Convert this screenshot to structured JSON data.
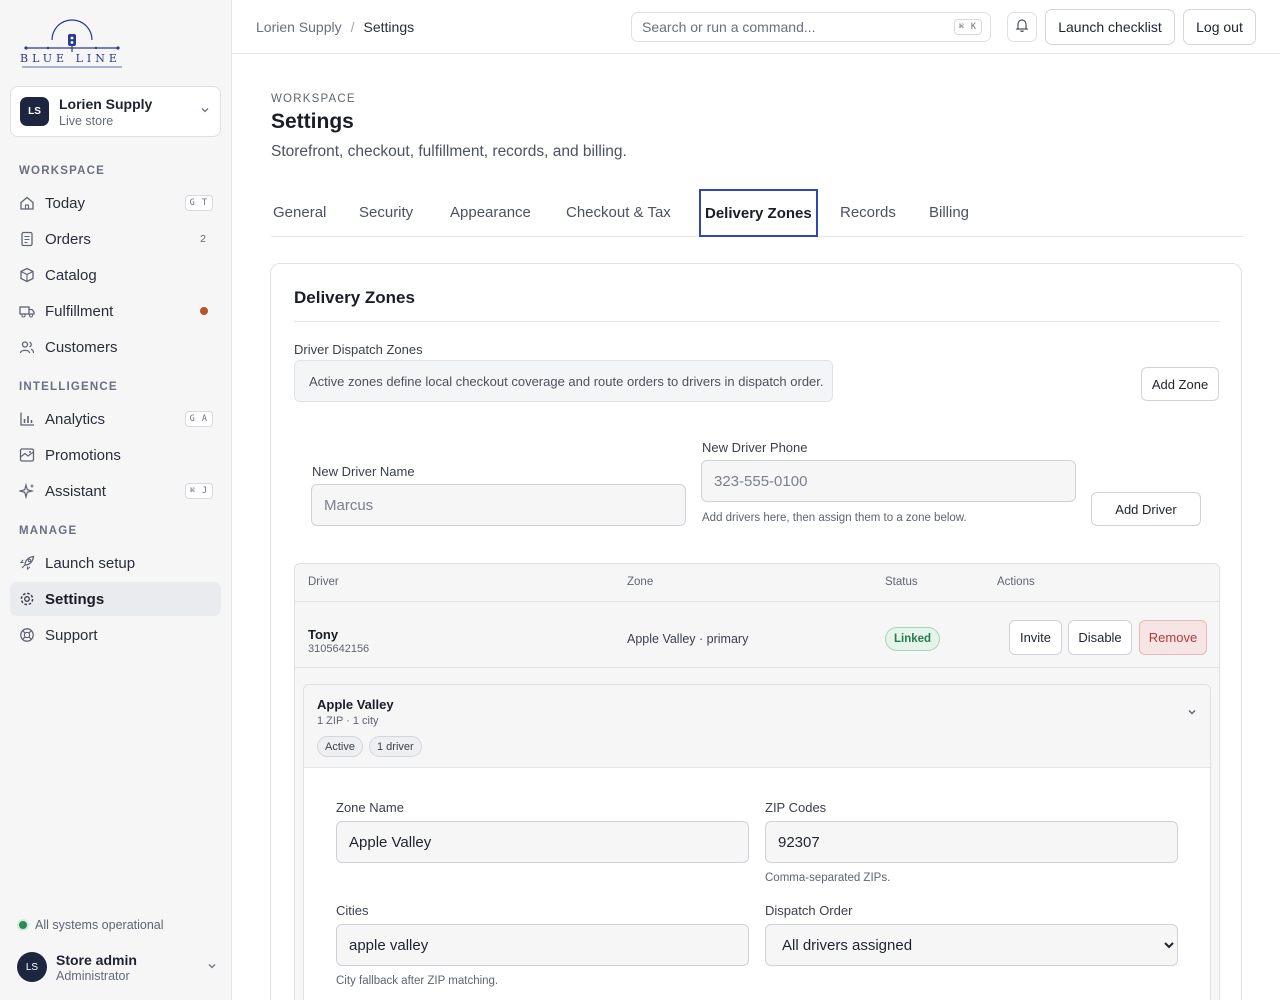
{
  "brand": {
    "logo_text": "BLUE LINE"
  },
  "store": {
    "initials": "LS",
    "name": "Lorien Supply",
    "sub": "Live store"
  },
  "sidebar": {
    "sections": [
      {
        "title": "WORKSPACE"
      },
      {
        "title": "INTELLIGENCE"
      },
      {
        "title": "MANAGE"
      }
    ],
    "items": [
      {
        "label": "Today",
        "icon": "home-icon",
        "kbd": "G T"
      },
      {
        "label": "Orders",
        "icon": "receipt-icon",
        "count": "2"
      },
      {
        "label": "Catalog",
        "icon": "box-icon"
      },
      {
        "label": "Fulfillment",
        "icon": "truck-icon",
        "badge_color": "#b5542b"
      },
      {
        "label": "Customers",
        "icon": "users-icon"
      },
      {
        "label": "Analytics",
        "icon": "bar-chart-icon",
        "kbd": "G A"
      },
      {
        "label": "Promotions",
        "icon": "tag-icon"
      },
      {
        "label": "Assistant",
        "icon": "sparkle-icon",
        "kbd": "⌘ J"
      },
      {
        "label": "Launch setup",
        "icon": "rocket-icon"
      },
      {
        "label": "Settings",
        "icon": "gear-icon",
        "active": true
      },
      {
        "label": "Support",
        "icon": "lifebuoy-icon"
      }
    ],
    "status": "All systems operational",
    "user": {
      "initials": "LS",
      "name": "Store admin",
      "role": "Administrator"
    }
  },
  "topbar": {
    "breadcrumb": [
      "Lorien Supply",
      "/",
      "Settings"
    ],
    "search_placeholder": "Search or run a command...",
    "search_kbd": "⌘ K",
    "launch_checklist": "Launch checklist",
    "logout": "Log out"
  },
  "page": {
    "eyebrow": "WORKSPACE",
    "title": "Settings",
    "subtitle": "Storefront, checkout, fulfillment, records, and billing.",
    "tabs": [
      "General",
      "Security",
      "Appearance",
      "Checkout & Tax",
      "Delivery Zones",
      "Records",
      "Billing"
    ],
    "active_tab": "Delivery Zones"
  },
  "delivery": {
    "title": "Delivery Zones",
    "dispatch_label": "Driver Dispatch Zones",
    "dispatch_info": "Active zones define local checkout coverage and route orders to drivers in dispatch order.",
    "add_zone": "Add Zone",
    "new_driver_name_label": "New Driver Name",
    "new_driver_name_placeholder": "Marcus",
    "new_driver_phone_label": "New Driver Phone",
    "new_driver_phone_placeholder": "323-555-0100",
    "driver_hint": "Add drivers here, then assign them to a zone below.",
    "add_driver": "Add Driver",
    "table": {
      "headers": [
        "Driver",
        "Zone",
        "Status",
        "Actions"
      ],
      "rows": [
        {
          "name": "Tony",
          "phone": "3105642156",
          "zone": "Apple Valley · primary",
          "status": "Linked",
          "actions": [
            "Invite",
            "Disable",
            "Remove"
          ]
        }
      ]
    },
    "zone": {
      "title": "Apple Valley",
      "meta": "1 ZIP · 1 city",
      "pills": [
        "Active",
        "1 driver"
      ],
      "zone_name_label": "Zone Name",
      "zone_name_value": "Apple Valley",
      "zip_label": "ZIP Codes",
      "zip_value": "92307",
      "zip_hint": "Comma-separated ZIPs.",
      "cities_label": "Cities",
      "cities_value": "apple valley",
      "cities_hint": "City fallback after ZIP matching.",
      "dispatch_label": "Dispatch Order",
      "dispatch_value": "All drivers assigned"
    }
  }
}
